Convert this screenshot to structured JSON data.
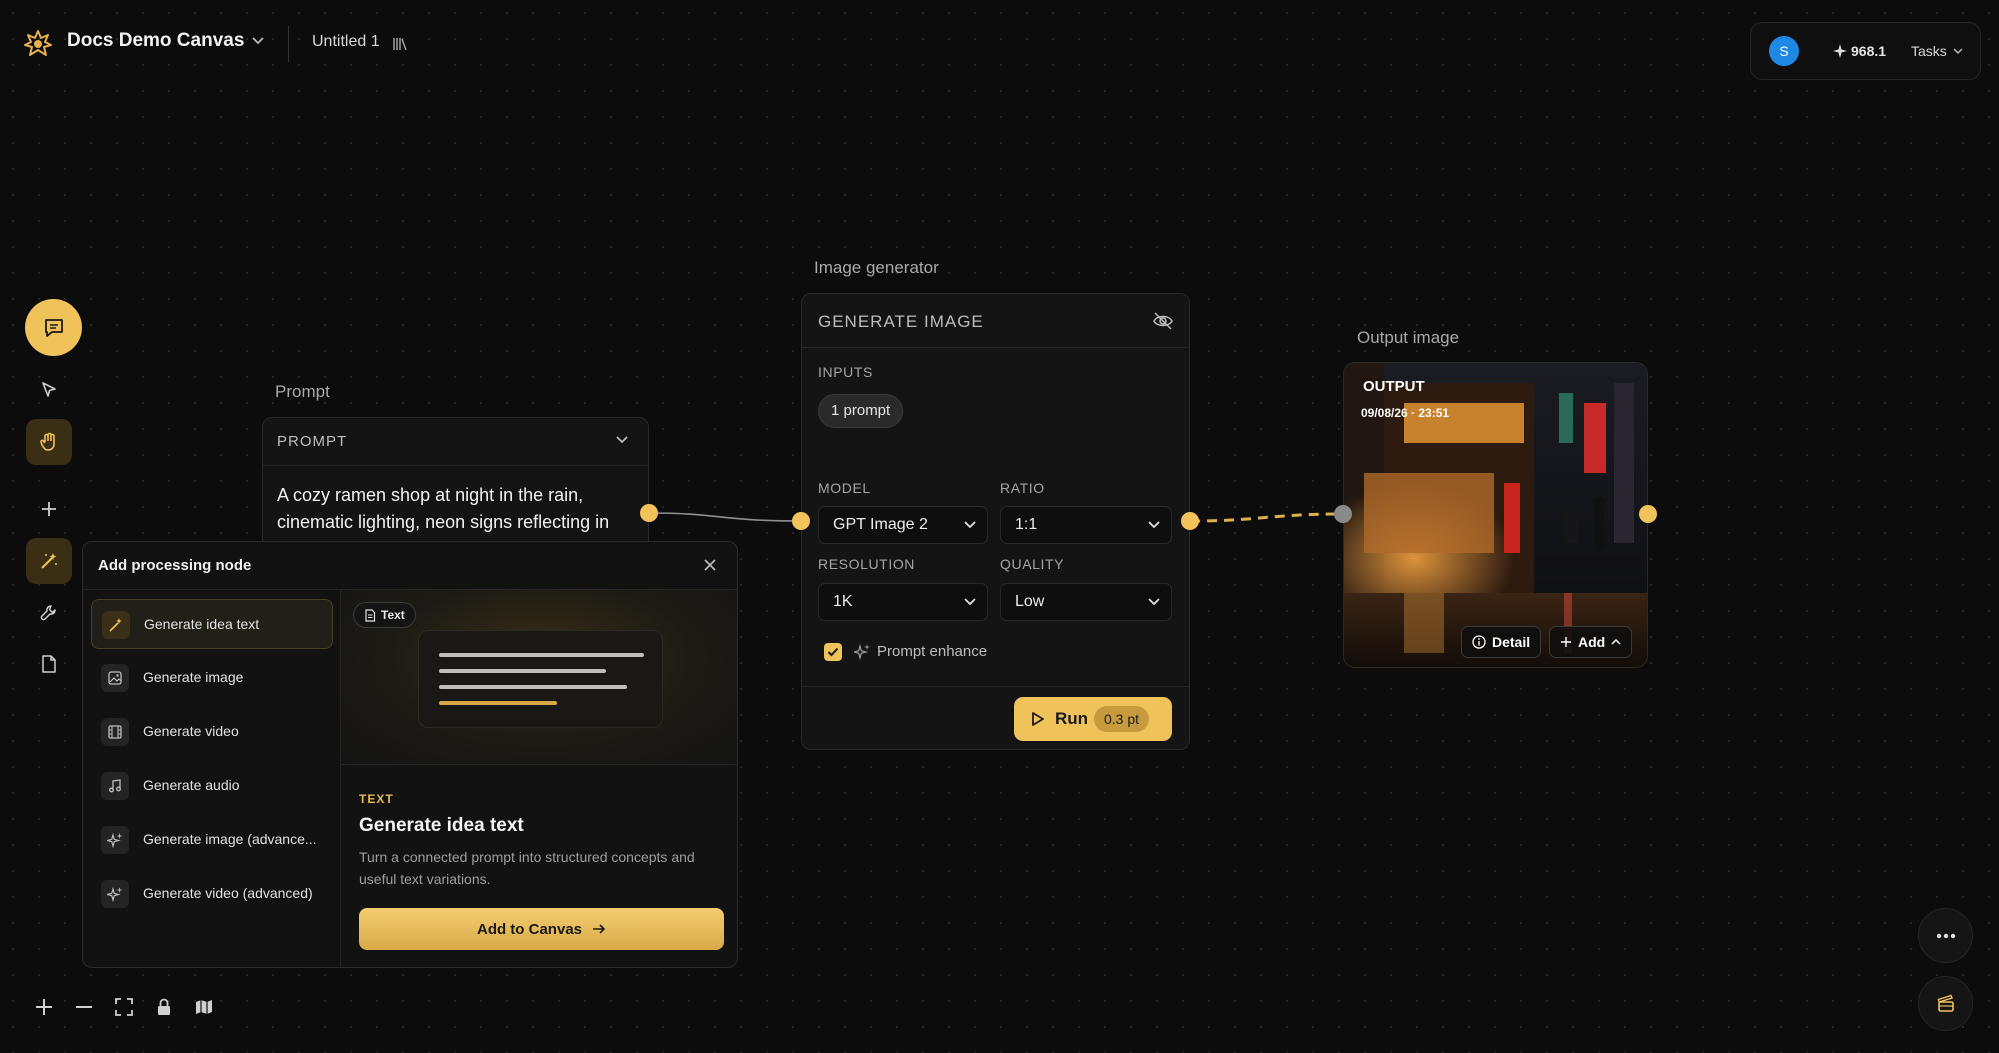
{
  "topbar": {
    "project_title": "Docs Demo Canvas",
    "file_title": "Untitled 1",
    "avatar_initial": "S",
    "credits": "968.1",
    "tasks_label": "Tasks"
  },
  "prompt_node": {
    "label": "Prompt",
    "header": "PROMPT",
    "text": "A cozy ramen shop at night in the rain, cinematic lighting, neon signs reflecting in puddles"
  },
  "generator_node": {
    "label": "Image generator",
    "header": "GENERATE IMAGE",
    "inputs_label": "INPUTS",
    "input_chip": "1 prompt",
    "model_label": "MODEL",
    "model_value": "GPT Image 2",
    "ratio_label": "RATIO",
    "ratio_value": "1:1",
    "resolution_label": "RESOLUTION",
    "resolution_value": "1K",
    "quality_label": "QUALITY",
    "quality_value": "Low",
    "prompt_enhance_label": "Prompt enhance",
    "prompt_enhance_checked": true,
    "run_label": "Run",
    "run_cost": "0.3 pt"
  },
  "output_node": {
    "label": "Output image",
    "badge": "OUTPUT",
    "timestamp": "09/08/26 · 23:51",
    "detail_label": "Detail",
    "add_label": "Add"
  },
  "add_panel": {
    "title": "Add processing node",
    "items": [
      {
        "label": "Generate idea text",
        "icon": "magic-wand-icon"
      },
      {
        "label": "Generate image",
        "icon": "image-icon"
      },
      {
        "label": "Generate video",
        "icon": "film-icon"
      },
      {
        "label": "Generate audio",
        "icon": "music-note-icon"
      },
      {
        "label": "Generate image (advance...",
        "icon": "sparkle-icon"
      },
      {
        "label": "Generate video (advanced)",
        "icon": "sparkle-icon"
      }
    ],
    "preview_tag": "Text",
    "detail_kicker": "TEXT",
    "detail_title": "Generate idea text",
    "detail_description": "Turn a connected prompt into structured concepts and useful text variations.",
    "add_button": "Add to Canvas"
  },
  "colors": {
    "accent": "#f0c25a",
    "background": "#0c0c0c",
    "node_bg": "#141414",
    "avatar": "#1e88e5"
  }
}
